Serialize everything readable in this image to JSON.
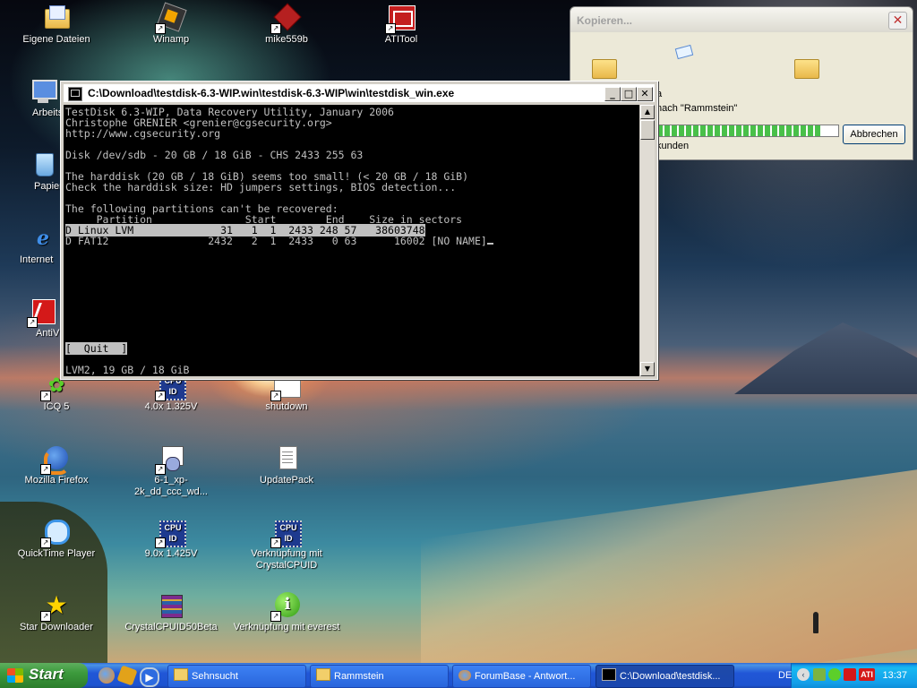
{
  "desktop": {
    "icons": [
      {
        "label": "Eigene Dateien",
        "icon": "folder-documents-icon"
      },
      {
        "label": "Winamp",
        "icon": "winamp-icon"
      },
      {
        "label": "mike559b",
        "icon": "app-icon"
      },
      {
        "label": "ATITool",
        "icon": "atitool-icon"
      },
      {
        "label": "Arbeits",
        "icon": "computer-icon"
      },
      {
        "label": "Papier",
        "icon": "recycle-bin-icon"
      },
      {
        "label": "Internet",
        "icon": "internet-explorer-icon"
      },
      {
        "label": "AntiV",
        "icon": "antivir-icon"
      },
      {
        "label": "ICQ 5",
        "icon": "icq-icon"
      },
      {
        "label": "4.0x 1.325V",
        "icon": "cpuid-icon"
      },
      {
        "label": "shutdown",
        "icon": "shortcut-icon"
      },
      {
        "label": "Mozilla Firefox",
        "icon": "firefox-icon"
      },
      {
        "label": "6-1_xp-2k_dd_ccc_wd...",
        "icon": "installer-icon"
      },
      {
        "label": "UpdatePack",
        "icon": "document-icon"
      },
      {
        "label": "QuickTime Player",
        "icon": "quicktime-icon"
      },
      {
        "label": "9.0x 1.425V",
        "icon": "cpuid-icon"
      },
      {
        "label": "Verknüpfung mit CrystalCPUID",
        "icon": "cpuid-icon"
      },
      {
        "label": "Star Downloader",
        "icon": "star-icon"
      },
      {
        "label": "CrystalCPUID50Beta",
        "icon": "winrar-icon"
      },
      {
        "label": "Verknüpfung mit everest",
        "icon": "info-icon"
      }
    ]
  },
  "console": {
    "title": "C:\\Download\\testdisk-6.3-WIP.win\\testdisk-6.3-WIP\\win\\testdisk_win.exe",
    "lines": {
      "l1": "TestDisk 6.3-WIP, Data Recovery Utility, January 2006",
      "l2": "Christophe GRENIER <grenier@cgsecurity.org>",
      "l3": "http://www.cgsecurity.org",
      "l4": "Disk /dev/sdb - 20 GB / 18 GiB - CHS 2433 255 63",
      "l5": "The harddisk (20 GB / 18 GiB) seems too small! (< 20 GB / 18 GiB)",
      "l6": "Check the harddisk size: HD jumpers settings, BIOS detection...",
      "l7": "The following partitions can't be recovered:",
      "header": "     Partition               Start        End    Size in sectors",
      "row1": "D Linux LVM              31   1  1  2433 248 57   38603748",
      "row2": "D FAT12                2432   2  1  2433   0 63      16002 [NO NAME]",
      "quit": "[  Quit  ]",
      "status": "LVM2, 19 GB / 18 GiB"
    }
  },
  "copy_dialog": {
    "title": "Kopieren...",
    "line1": "a",
    "line2": "nach \"Rammstein\"",
    "line3": "kunden",
    "cancel_label": "Abbrechen",
    "progress": 0.9
  },
  "taskbar": {
    "start_label": "Start",
    "tasks": [
      {
        "label": "Sehnsucht",
        "active": false
      },
      {
        "label": "Rammstein",
        "active": false
      },
      {
        "label": "ForumBase - Antwort...",
        "active": false
      },
      {
        "label": "C:\\Download\\testdisk...",
        "active": true
      }
    ],
    "language": "DE",
    "clock": "13:37"
  }
}
